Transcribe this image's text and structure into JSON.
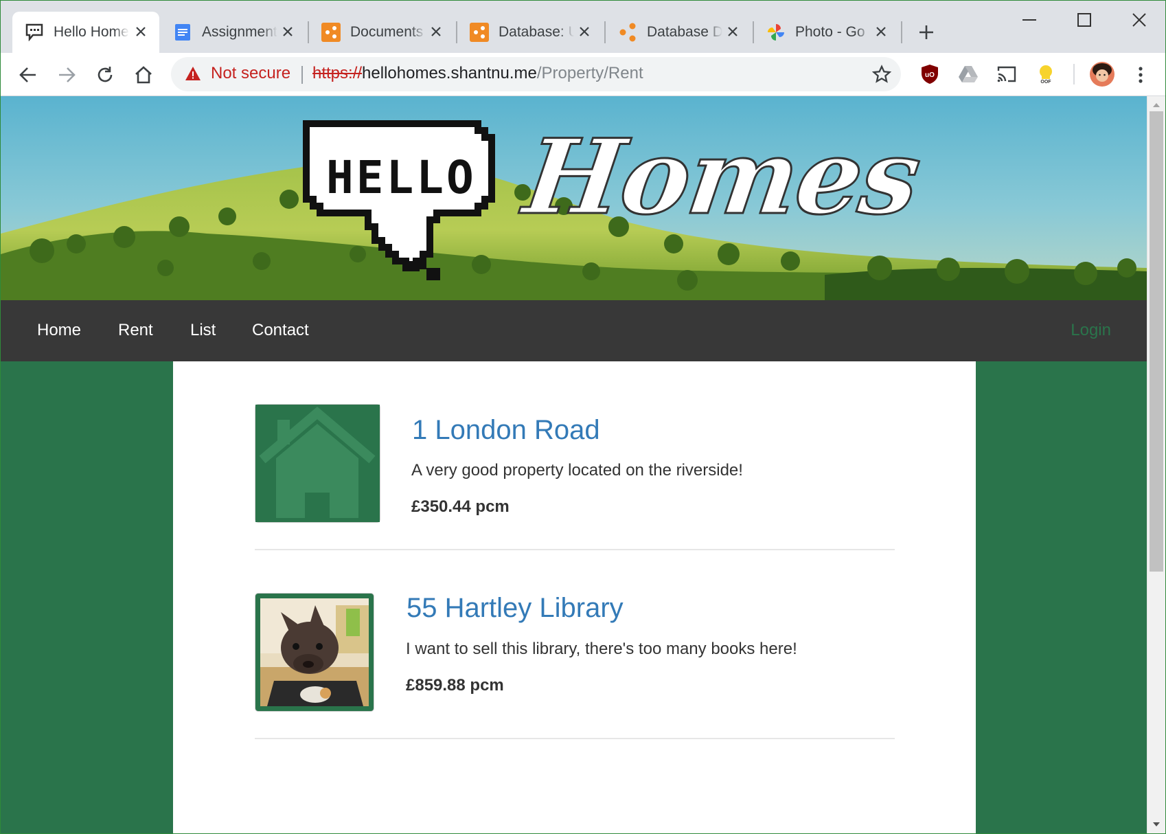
{
  "browser": {
    "tabs": [
      {
        "title": "Hello Homes",
        "favicon": "speech-bubble-icon",
        "active": true
      },
      {
        "title": "Assignment",
        "favicon": "docs-icon",
        "active": false
      },
      {
        "title": "Documents",
        "favicon": "app-icon",
        "active": false
      },
      {
        "title": "Database: U",
        "favicon": "app-icon",
        "active": false
      },
      {
        "title": "Database D",
        "favicon": "share-icon",
        "active": false
      },
      {
        "title": "Photo - Go",
        "favicon": "photos-pinwheel-icon",
        "active": false
      }
    ],
    "omnibox": {
      "security": "Not secure",
      "url_scheme": "https://",
      "url_host": "hellohomes.shantnu.me",
      "url_path": "/Property/Rent"
    },
    "ext_label": "OOF"
  },
  "site": {
    "logo_text": "HELLO",
    "brand": "Homes",
    "nav": {
      "items": [
        "Home",
        "Rent",
        "List",
        "Contact"
      ],
      "login": "Login"
    },
    "listings": [
      {
        "title": "1 London Road",
        "description": "A very good property located on the riverside!",
        "price": "£350.44 pcm",
        "image": "house-placeholder-icon"
      },
      {
        "title": "55 Hartley Library",
        "description": "I want to sell this library, there's too many books here!",
        "price": "£859.88 pcm",
        "image": "dog-photo"
      }
    ]
  },
  "colors": {
    "brand_green": "#2a744b",
    "nav_dark": "#383838",
    "link_blue": "#337ab7",
    "warning_red": "#c5221f"
  }
}
